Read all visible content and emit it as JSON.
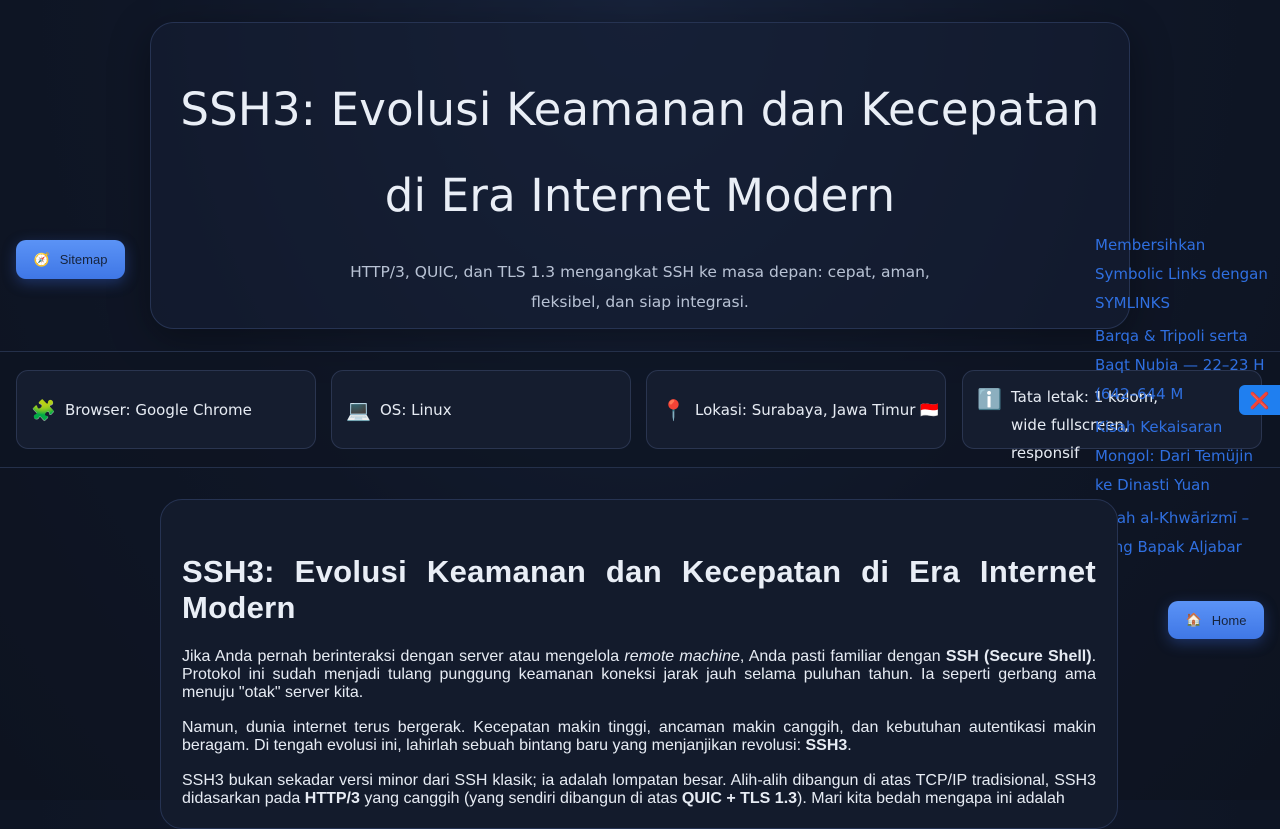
{
  "hero": {
    "title": "SSH3: Evolusi Keamanan dan Kecepatan di Era Internet Modern",
    "subtitle": "HTTP/3, QUIC, dan TLS 1.3 mengangkat SSH ke masa depan: cepat, aman, fleksibel, dan siap integrasi."
  },
  "info_cards": [
    {
      "icon": "puzzle-icon",
      "glyph": "🧩",
      "text": "Browser: Google Chrome"
    },
    {
      "icon": "laptop-icon",
      "glyph": "💻",
      "text": "OS: Linux"
    },
    {
      "icon": "pin-icon",
      "glyph": "📍",
      "text": "Lokasi: Surabaya, Jawa Timur 🇮🇩"
    },
    {
      "icon": "info-icon",
      "glyph": "ℹ️",
      "text": "Tata letak: 1 kolom, wide fullscreen, responsif"
    }
  ],
  "nav": {
    "sitemap_label": "Sitemap",
    "sitemap_glyph": "🧭",
    "home_label": "Home",
    "home_glyph": "🏠",
    "close_glyph": "❌"
  },
  "side_links": [
    "Membersihkan Symbolic Links dengan SYMLINKS",
    "Barqa & Tripoli serta Baqt Nubia — 22–23 H (642–644 M",
    "Kisah Kekaisaran Mongol: Dari Temüjin ke Dinasti Yuan",
    "Kisah al-Khwārizmī – Sang Bapak Aljabar"
  ],
  "article": {
    "heading": "SSH3: Evolusi Keamanan dan Kecepatan di Era Internet Modern",
    "p1": {
      "a": "Jika Anda pernah berinteraksi dengan server atau mengelola ",
      "em": "remote machine",
      "b": ", Anda pasti familiar dengan ",
      "strong": "SSH (Secure Shell)",
      "c": ". Protokol ini sudah menjadi tulang punggung keamanan koneksi jarak jauh selama puluhan tahun. Ia seperti gerbang ama menuju \"otak\" server kita."
    },
    "p2": {
      "a": "Namun, dunia internet terus bergerak. Kecepatan makin tinggi, ancaman makin canggih, dan kebutuhan autentikasi makin beragam. Di tengah evolusi ini, lahirlah sebuah bintang baru yang menjanjikan revolusi: ",
      "strong": "SSH3",
      "b": "."
    },
    "p3": {
      "a": "SSH3 bukan sekadar versi minor dari SSH klasik; ia adalah lompatan besar. Alih-alih dibangun di atas TCP/IP tradisional, SSH3 didasarkan pada ",
      "strong1": "HTTP/3",
      "b": " yang canggih (yang sendiri dibangun di atas ",
      "strong2": "QUIC + TLS 1.3",
      "c": "). Mari kita bedah mengapa ini adalah"
    }
  }
}
